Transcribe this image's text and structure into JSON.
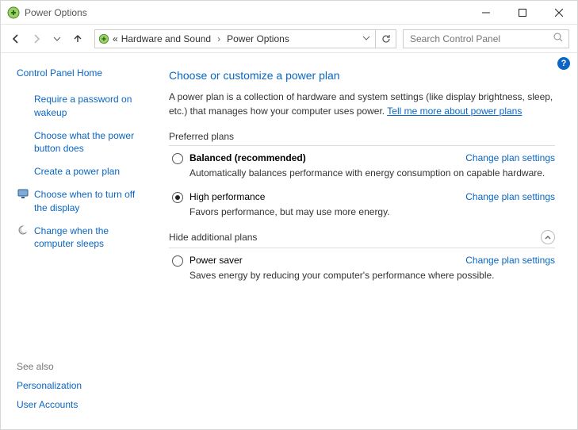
{
  "window": {
    "title": "Power Options"
  },
  "breadcrumb": {
    "prefix": "«",
    "items": [
      "Hardware and Sound",
      "Power Options"
    ]
  },
  "search": {
    "placeholder": "Search Control Panel"
  },
  "sidebar": {
    "home": "Control Panel Home",
    "links": [
      "Require a password on wakeup",
      "Choose what the power button does",
      "Create a power plan",
      "Choose when to turn off the display",
      "Change when the computer sleeps"
    ]
  },
  "seealso": {
    "label": "See also",
    "links": [
      "Personalization",
      "User Accounts"
    ]
  },
  "main": {
    "heading": "Choose or customize a power plan",
    "description_pre": "A power plan is a collection of hardware and system settings (like display brightness, sleep, etc.) that manages how your computer uses power. ",
    "description_link": "Tell me more about power plans",
    "preferred_label": "Preferred plans",
    "hide_label": "Hide additional plans",
    "change_settings": "Change plan settings",
    "plans": [
      {
        "name": "Balanced (recommended)",
        "sub": "Automatically balances performance with energy consumption on capable hardware.",
        "selected": false,
        "bold": true
      },
      {
        "name": "High performance",
        "sub": "Favors performance, but may use more energy.",
        "selected": true,
        "bold": false
      }
    ],
    "additional_plans": [
      {
        "name": "Power saver",
        "sub": "Saves energy by reducing your computer's performance where possible.",
        "selected": false,
        "bold": false
      }
    ]
  },
  "help": "?"
}
